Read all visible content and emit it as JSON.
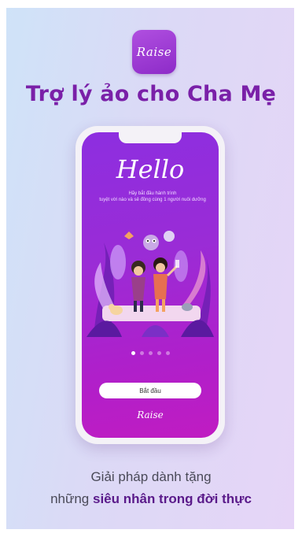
{
  "app": {
    "logo_text": "Raise",
    "title": "Trợ lý ảo cho Cha Mẹ"
  },
  "phone": {
    "hello": "Hello",
    "subtitle_line1": "Hãy bắt đầu hành trình",
    "subtitle_line2": "tuyệt vời nào và sẻ đồng cùng 1 người nuôi dưỡng",
    "start_button": "Bắt đầu",
    "screen_logo": "Raise",
    "pagination": {
      "count": 5,
      "active_index": 0
    }
  },
  "tagline": {
    "line1": "Giải pháp dành tặng",
    "line2_prefix": "những ",
    "line2_bold": "siêu nhân trong đời thực"
  },
  "colors": {
    "title": "#7a20a8",
    "screen_gradient_start": "#8d2ee0",
    "screen_gradient_end": "#c01cc2"
  }
}
